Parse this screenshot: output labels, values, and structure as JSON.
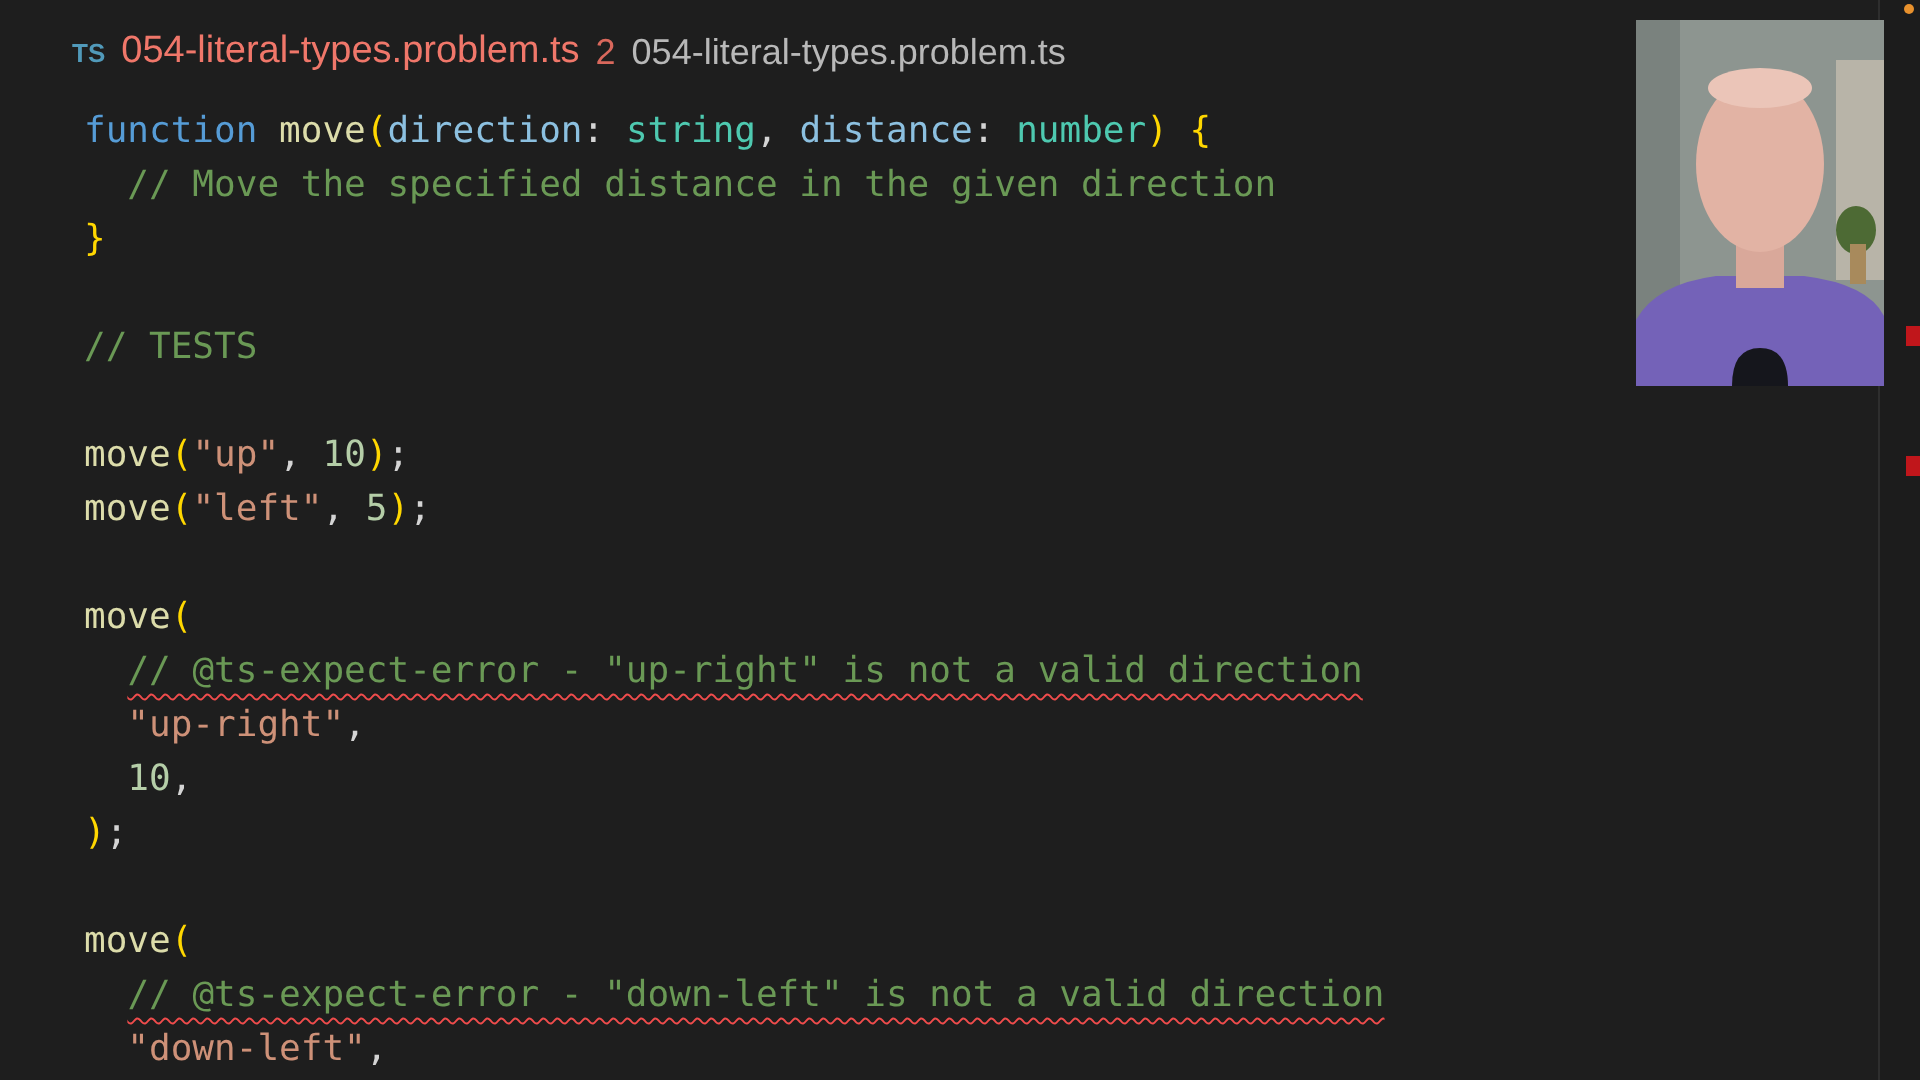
{
  "tab": {
    "icon_text": "TS",
    "filename": "054-literal-types.problem.ts",
    "problem_count": "2",
    "breadcrumb": "054-literal-types.problem.ts"
  },
  "editor": {
    "lines": [
      {
        "kind": "code",
        "tokens": [
          {
            "text": "function",
            "kind": "keyword"
          },
          {
            "text": " move",
            "kind": "function"
          },
          {
            "text": "(",
            "kind": "bracket"
          },
          {
            "text": "direction",
            "kind": "param"
          },
          {
            "text": ": ",
            "kind": "punct"
          },
          {
            "text": "string",
            "kind": "type"
          },
          {
            "text": ", ",
            "kind": "punct"
          },
          {
            "text": "distance",
            "kind": "param"
          },
          {
            "text": ": ",
            "kind": "punct"
          },
          {
            "text": "number",
            "kind": "type"
          },
          {
            "text": ") {",
            "kind": "bracket"
          }
        ]
      },
      {
        "kind": "code",
        "tokens": [
          {
            "text": "  // Move the specified distance in the given direction",
            "kind": "comment"
          }
        ]
      },
      {
        "kind": "code",
        "tokens": [
          {
            "text": "}",
            "kind": "bracket"
          }
        ]
      },
      {
        "kind": "blank"
      },
      {
        "kind": "code",
        "tokens": [
          {
            "text": "// TESTS",
            "kind": "comment"
          }
        ]
      },
      {
        "kind": "blank"
      },
      {
        "kind": "code",
        "tokens": [
          {
            "text": "move",
            "kind": "function"
          },
          {
            "text": "(",
            "kind": "bracket"
          },
          {
            "text": "\"up\"",
            "kind": "string"
          },
          {
            "text": ", ",
            "kind": "punct"
          },
          {
            "text": "10",
            "kind": "number"
          },
          {
            "text": ")",
            "kind": "bracket"
          },
          {
            "text": ";",
            "kind": "punct"
          }
        ]
      },
      {
        "kind": "code",
        "tokens": [
          {
            "text": "move",
            "kind": "function"
          },
          {
            "text": "(",
            "kind": "bracket"
          },
          {
            "text": "\"left\"",
            "kind": "string"
          },
          {
            "text": ", ",
            "kind": "punct"
          },
          {
            "text": "5",
            "kind": "number"
          },
          {
            "text": ")",
            "kind": "bracket"
          },
          {
            "text": ";",
            "kind": "punct"
          }
        ]
      },
      {
        "kind": "blank"
      },
      {
        "kind": "code",
        "tokens": [
          {
            "text": "move",
            "kind": "function"
          },
          {
            "text": "(",
            "kind": "bracket"
          }
        ]
      },
      {
        "kind": "error",
        "tokens": [
          {
            "text": "  // @ts-expect-error - \"up-right\" is not a valid direction",
            "kind": "comment"
          }
        ]
      },
      {
        "kind": "code",
        "tokens": [
          {
            "text": "  \"up-right\"",
            "kind": "string"
          },
          {
            "text": ",",
            "kind": "punct"
          }
        ]
      },
      {
        "kind": "code",
        "tokens": [
          {
            "text": "  10",
            "kind": "number"
          },
          {
            "text": ",",
            "kind": "punct"
          }
        ]
      },
      {
        "kind": "code",
        "tokens": [
          {
            "text": ")",
            "kind": "bracket"
          },
          {
            "text": ";",
            "kind": "punct"
          }
        ]
      },
      {
        "kind": "blank"
      },
      {
        "kind": "code",
        "tokens": [
          {
            "text": "move",
            "kind": "function"
          },
          {
            "text": "(",
            "kind": "bracket"
          }
        ]
      },
      {
        "kind": "error",
        "tokens": [
          {
            "text": "  // @ts-expect-error - \"down-left\" is not a valid direction",
            "kind": "comment"
          }
        ]
      },
      {
        "kind": "code",
        "tokens": [
          {
            "text": "  \"down-left\"",
            "kind": "string"
          },
          {
            "text": ",",
            "kind": "punct"
          }
        ]
      }
    ]
  }
}
